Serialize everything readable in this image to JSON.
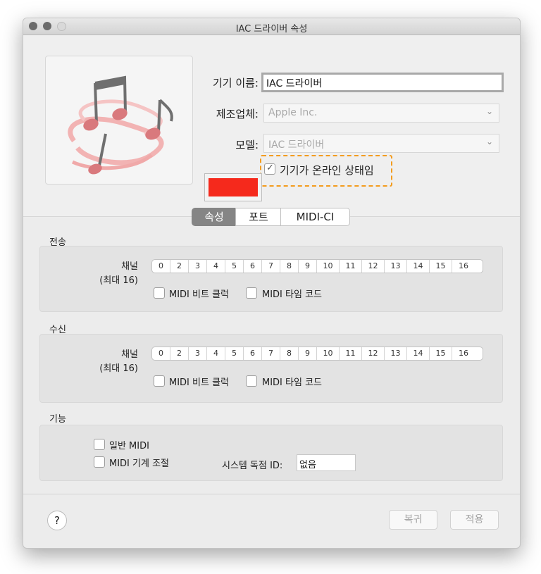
{
  "window": {
    "title": "IAC 드라이버 속성"
  },
  "device": {
    "name_label": "기기 이름:",
    "name_value": "IAC 드라이버",
    "manufacturer_label": "제조업체:",
    "manufacturer_value": "Apple Inc.",
    "model_label": "모델:",
    "model_value": "IAC 드라이버",
    "online_label": "기기가 온라인 상태임",
    "online_checked": true,
    "color": "#f5291c",
    "highlight_color": "#f39c1e"
  },
  "tabs": [
    {
      "label": "속성",
      "selected": true
    },
    {
      "label": "포트",
      "selected": false
    },
    {
      "label": "MIDI-CI",
      "selected": false
    }
  ],
  "channels": [
    "0",
    "2",
    "3",
    "4",
    "5",
    "6",
    "7",
    "8",
    "9",
    "10",
    "11",
    "12",
    "13",
    "14",
    "15",
    "16"
  ],
  "transmit": {
    "section_label": "전송",
    "channel_label": "채널",
    "channel_max": "(최대 16)",
    "beat_clock": "MIDI 비트 클럭",
    "time_code": "MIDI 타임 코드"
  },
  "receive": {
    "section_label": "수신",
    "channel_label": "채널",
    "channel_max": "(최대 16)",
    "beat_clock": "MIDI 비트 클럭",
    "time_code": "MIDI 타임 코드"
  },
  "features": {
    "section_label": "기능",
    "general_midi": "일반 MIDI",
    "machine_control": "MIDI 기계 조절",
    "sysex_label": "시스템 독점 ID:",
    "sysex_value": "없음"
  },
  "footer": {
    "help": "?",
    "revert": "복귀",
    "apply": "적용"
  }
}
